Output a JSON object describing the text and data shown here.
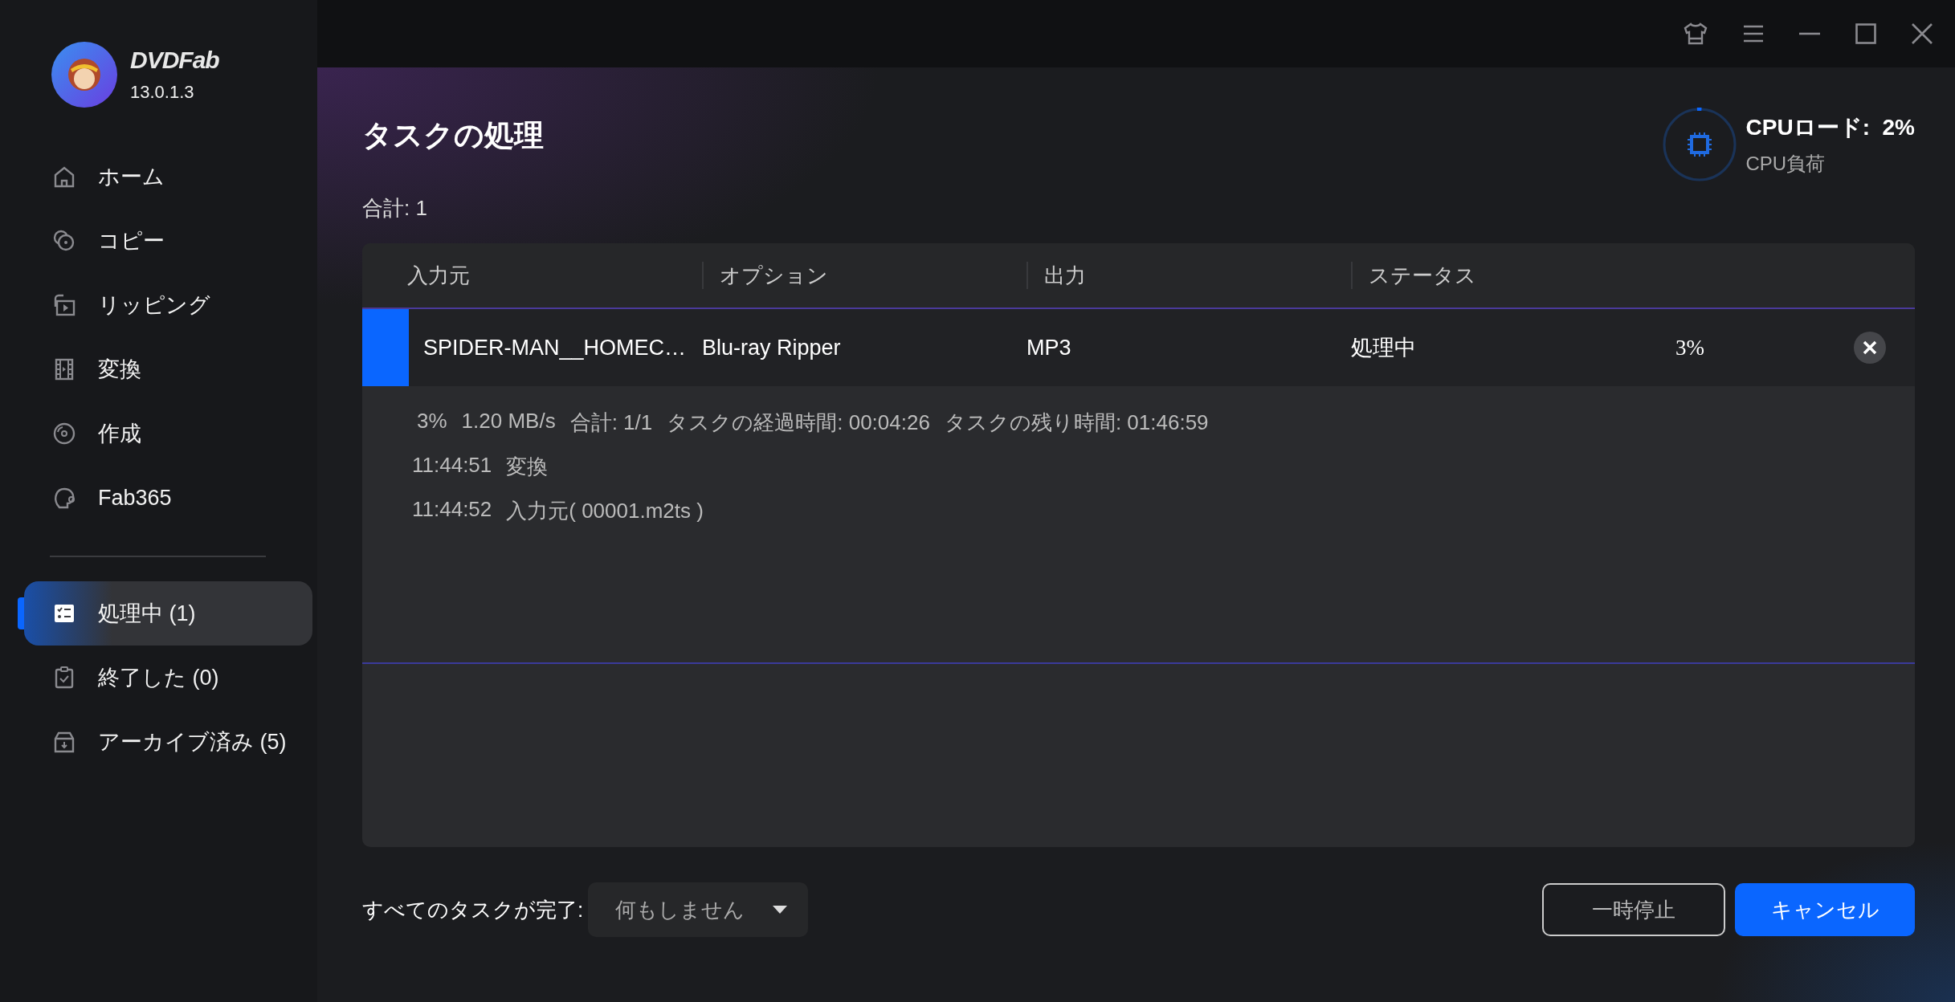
{
  "app": {
    "logo_text": "DVDFab",
    "version": "13.0.1.3"
  },
  "nav": [
    {
      "label": "ホーム",
      "selected": false
    },
    {
      "label": "コピー",
      "selected": false
    },
    {
      "label": "リッピング",
      "selected": false
    },
    {
      "label": "変換",
      "selected": false
    },
    {
      "label": "作成",
      "selected": false
    },
    {
      "label": "Fab365",
      "selected": false
    }
  ],
  "queue_nav": [
    {
      "label": "処理中 (1)",
      "selected": true
    },
    {
      "label": "終了した (0)",
      "selected": false
    },
    {
      "label": "アーカイブ済み (5)",
      "selected": false
    }
  ],
  "page": {
    "title": "タスクの処理",
    "total": "合計: 1"
  },
  "cpu": {
    "title": "CPUロード:  2%",
    "subtitle": "CPU負荷",
    "level": 0.02
  },
  "table": {
    "columns": [
      "入力元",
      "オプション",
      "出力",
      "ステータス"
    ],
    "rows": [
      {
        "source": "SPIDER-MAN__HOMEC…",
        "option": "Blu-ray Ripper",
        "output": "MP3",
        "status": "処理中",
        "percent": "3%",
        "level": 0.03,
        "stats": [
          "3%",
          "1.20 MB/s",
          "合計: 1/1",
          "タスクの経過時間: 00:04:26",
          "タスクの残り時間: 01:46:59"
        ],
        "log": [
          {
            "time": "11:44:51",
            "message": "変換"
          },
          {
            "time": "11:44:52",
            "message": "入力元( 00001.m2ts )"
          }
        ]
      }
    ]
  },
  "footer": {
    "label": "すべてのタスクが完了:",
    "dropdown": "何もしません",
    "buttons": [
      {
        "label": "一時停止",
        "kind": "outline"
      },
      {
        "label": "キャンセル",
        "kind": "primary"
      }
    ]
  }
}
